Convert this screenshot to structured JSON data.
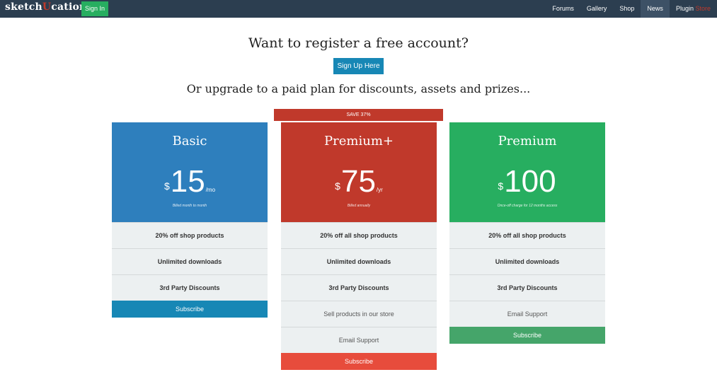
{
  "nav": {
    "logo_left": "sketch",
    "logo_mid": "U",
    "logo_right": "cation",
    "signin_label": "Sign In",
    "links": [
      "Forums",
      "Gallery",
      "Shop",
      "News",
      "Plugin"
    ],
    "plugin_suffix": "Store",
    "colors": {
      "bar": "#2c3e50",
      "signin": "#27ae60",
      "accent": "#c0392b"
    }
  },
  "hero": {
    "headline": "Want to register a free account?",
    "signup_label": "Sign Up Here",
    "subline": "Or upgrade to a paid plan for discounts, assets and prizes..."
  },
  "banner": {
    "save_label": "SAVE 37%"
  },
  "plans": [
    {
      "name": "Basic",
      "currency": "$",
      "price": "15",
      "period": "/mo",
      "billing": "Billed month to month",
      "color": "#2e7fbd",
      "features": [
        "20% off shop products",
        "Unlimited downloads",
        "3rd Party Discounts"
      ],
      "subscribe_label": "Subscribe"
    },
    {
      "name": "Premium+",
      "currency": "$",
      "price": "75",
      "period": "/yr",
      "billing": "Billed annually",
      "color": "#c0392b",
      "features": [
        "20% off all shop products",
        "Unlimited downloads",
        "3rd Party Discounts",
        "Sell products in our store",
        "Email Support"
      ],
      "subscribe_label": "Subscribe"
    },
    {
      "name": "Premium",
      "currency": "$",
      "price": "100",
      "period": "",
      "billing": "Once-off charge for 12 months access",
      "color": "#27ae60",
      "features": [
        "20% off all shop products",
        "Unlimited downloads",
        "3rd Party Discounts",
        "Email Support"
      ],
      "subscribe_label": "Subscribe"
    }
  ]
}
